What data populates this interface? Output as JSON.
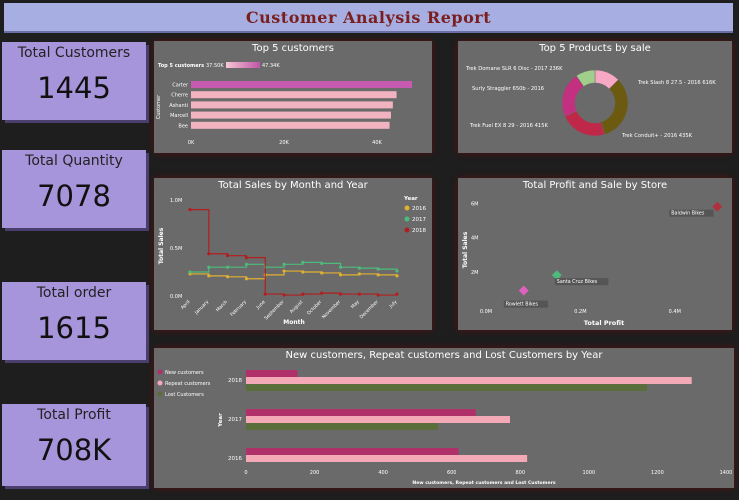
{
  "title": "Customer Analysis Report",
  "kpis": [
    {
      "label": "Total Customers",
      "value": "1445"
    },
    {
      "label": "Total Quantity",
      "value": "7078"
    },
    {
      "label": "Total order",
      "value": "1615"
    },
    {
      "label": "Total Profit",
      "value": "708K"
    }
  ],
  "colors": {
    "accent": "#a795dc",
    "banner": "#a6aee2",
    "panel": "#6a6a6a",
    "title_text": "#7a1e1e"
  },
  "chart_data": [
    {
      "type": "bar",
      "title": "Top 5 customers",
      "ylabel": "Customer",
      "categories": [
        "Carter",
        "Cherre",
        "Ashanti",
        "Marcell",
        "Bee"
      ],
      "values": [
        47.3,
        44.0,
        43.2,
        42.8,
        42.5
      ],
      "xticks": [
        "0K",
        "20K",
        "40K"
      ],
      "xlim": [
        0,
        47.3
      ],
      "legend_title": "Top 5 customers",
      "legend_min": "37.50K",
      "legend_max": "47.34K"
    },
    {
      "type": "pie",
      "title": "Top 5 Products by sale",
      "labels": [
        "Trek Domane SLR 6 Disc - 2017 236K",
        "Trek Slash 8 27.5 - 2016 616K",
        "Trek Conduit+ - 2016 435K",
        "Trek Fuel EX 8 29 - 2016 415K",
        "Surly Straggler 650b - 2016"
      ],
      "values": [
        236,
        616,
        435,
        415,
        180
      ],
      "colors": [
        "#f7a8c4",
        "#6b5a0f",
        "#c0284a",
        "#c2307f",
        "#9fcf8a"
      ]
    },
    {
      "type": "line",
      "title": "Total Sales by Month and Year",
      "xlabel": "Month",
      "ylabel": "Total Sales",
      "categories": [
        "April",
        "January",
        "March",
        "February",
        "June",
        "September",
        "August",
        "October",
        "November",
        "May",
        "December",
        "July"
      ],
      "yticks": [
        "0.0M",
        "0.5M",
        "1.0M"
      ],
      "ylim": [
        0,
        1.0
      ],
      "legend_title": "Year",
      "series": [
        {
          "name": "2016",
          "color": "#e0b030",
          "values": [
            0.23,
            0.21,
            0.2,
            0.18,
            0.22,
            0.26,
            0.25,
            0.24,
            0.22,
            0.23,
            0.22,
            0.21
          ]
        },
        {
          "name": "2017",
          "color": "#4dbb7a",
          "values": [
            0.25,
            0.3,
            0.3,
            0.33,
            0.3,
            0.33,
            0.35,
            0.34,
            0.3,
            0.29,
            0.28,
            0.26
          ]
        },
        {
          "name": "2018",
          "color": "#b21e1e",
          "values": [
            0.9,
            0.44,
            0.42,
            0.4,
            0.02,
            0.01,
            0.02,
            0.03,
            0.02,
            0.02,
            0.01,
            0.02
          ]
        }
      ]
    },
    {
      "type": "scatter",
      "title": "Total Profit and Sale by Store",
      "xlabel": "Total Profit",
      "ylabel": "Total Sales",
      "xticks": [
        "0.0M",
        "0.2M",
        "0.4M"
      ],
      "yticks": [
        "2M",
        "4M",
        "6M"
      ],
      "xlim": [
        0,
        0.5
      ],
      "ylim": [
        0,
        6.6
      ],
      "points": [
        {
          "label": "Baldwin Bikes",
          "x": 0.49,
          "y": 5.8,
          "color": "#b03040"
        },
        {
          "label": "Santa Cruz Bikes",
          "x": 0.15,
          "y": 1.8,
          "color": "#4dbb7a"
        },
        {
          "label": "Rowlett Bikes",
          "x": 0.08,
          "y": 0.9,
          "color": "#e060c0"
        }
      ]
    },
    {
      "type": "bar",
      "title": "New customers, Repeat customers and Lost Customers by Year",
      "xlabel": "New customers, Repeat customers and Lost Customers",
      "ylabel": "Year",
      "categories": [
        "2018",
        "2017",
        "2016"
      ],
      "xticks": [
        "0",
        "200",
        "400",
        "600",
        "800",
        "1000",
        "1200",
        "1400"
      ],
      "xlim": [
        0,
        1400
      ],
      "series": [
        {
          "name": "New customers",
          "color": "#b0306a",
          "values": [
            150,
            670,
            620
          ]
        },
        {
          "name": "Repeat customers",
          "color": "#f4a9b6",
          "values": [
            1300,
            770,
            820
          ]
        },
        {
          "name": "Lost Customers",
          "color": "#5a6e3c",
          "values": [
            1170,
            560,
            0
          ]
        }
      ]
    }
  ]
}
